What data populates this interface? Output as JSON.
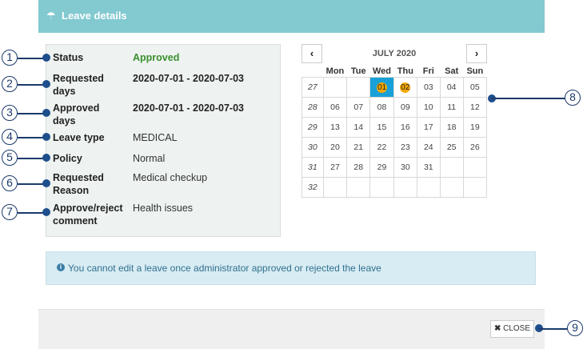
{
  "header": {
    "title": "Leave details",
    "icon": "umbrella-icon"
  },
  "details": [
    {
      "label": "Status",
      "value": "Approved",
      "callout": "1"
    },
    {
      "label": "Requested days",
      "value": "2020-07-01 - 2020-07-03",
      "callout": "2"
    },
    {
      "label": "Approved days",
      "value": "2020-07-01 - 2020-07-03",
      "callout": "3"
    },
    {
      "label": "Leave type",
      "value": "MEDICAL",
      "callout": "4"
    },
    {
      "label": "Policy",
      "value": "Normal",
      "callout": "5"
    },
    {
      "label": "Requested Reason",
      "value": "Medical checkup",
      "callout": "6"
    },
    {
      "label": "Approve/reject comment",
      "value": "Health issues",
      "callout": "7"
    }
  ],
  "calendar": {
    "month_label": "JULY 2020",
    "prev": "‹",
    "next": "›",
    "weekdays": [
      "Mon",
      "Tue",
      "Wed",
      "Thu",
      "Fri",
      "Sat",
      "Sun"
    ],
    "weeks": [
      {
        "num": "27",
        "days": [
          "",
          "",
          "01",
          "02",
          "03",
          "04",
          "05"
        ]
      },
      {
        "num": "28",
        "days": [
          "06",
          "07",
          "08",
          "09",
          "10",
          "11",
          "12"
        ]
      },
      {
        "num": "29",
        "days": [
          "13",
          "14",
          "15",
          "16",
          "17",
          "18",
          "19"
        ]
      },
      {
        "num": "30",
        "days": [
          "20",
          "21",
          "22",
          "23",
          "24",
          "25",
          "26"
        ]
      },
      {
        "num": "31",
        "days": [
          "27",
          "28",
          "29",
          "30",
          "31",
          "",
          ""
        ]
      },
      {
        "num": "32",
        "days": [
          "",
          "",
          "",
          "",
          "",
          "",
          ""
        ]
      }
    ],
    "callout": "8"
  },
  "info": {
    "text": "You cannot edit a leave once administrator approved or rejected the leave"
  },
  "footer": {
    "close_label": "CLOSE",
    "callout": "9"
  },
  "colors": {
    "header": "#82c9d0",
    "approved": "#3a8f2e",
    "today": "#1aa0d8",
    "leave_day": "#f5a800"
  }
}
